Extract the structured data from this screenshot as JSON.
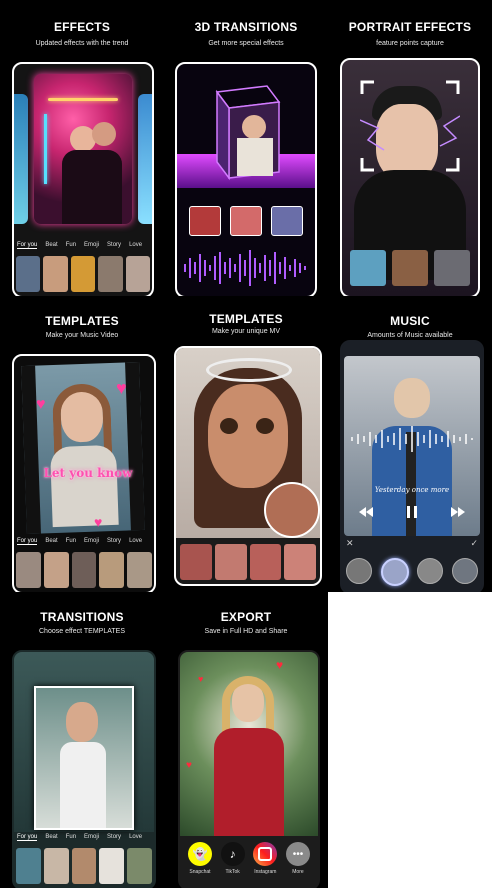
{
  "panels": [
    {
      "title": "EFFECTS",
      "subtitle": "Updated effects with the trend"
    },
    {
      "title": "3D TRANSITIONS",
      "subtitle": "Get more special effects"
    },
    {
      "title": "PORTRAIT EFFECTS",
      "subtitle": "feature points capture"
    },
    {
      "title": "TEMPLATES",
      "subtitle": "Make your Music Video"
    },
    {
      "title": "TEMPLATES",
      "subtitle": "Make your unique MV"
    },
    {
      "title": "MUSIC",
      "subtitle": "Amounts of Music available"
    },
    {
      "title": "TRANSITIONS",
      "subtitle": "Choose effect TEMPLATES"
    },
    {
      "title": "EXPORT",
      "subtitle": "Save in Full HD and Share"
    }
  ],
  "category_tabs": [
    "For you",
    "Beat",
    "Fun",
    "Emoji",
    "Story",
    "Love"
  ],
  "templates_overlay_text": "Let you know",
  "music_caption": "Yesterday once more",
  "share_targets": [
    "Snapchat",
    "TikTok",
    "Instagram",
    "More"
  ],
  "colors": {
    "background": "#000000",
    "neon_purple": "#b94cff",
    "neon_pink": "#ff3fa4",
    "accent_cyan": "#4fd8ff"
  },
  "icons": {
    "music_controls": [
      "previous-icon",
      "pause-icon",
      "next-icon"
    ],
    "music_bottom": [
      "close-icon",
      "check-icon"
    ]
  }
}
